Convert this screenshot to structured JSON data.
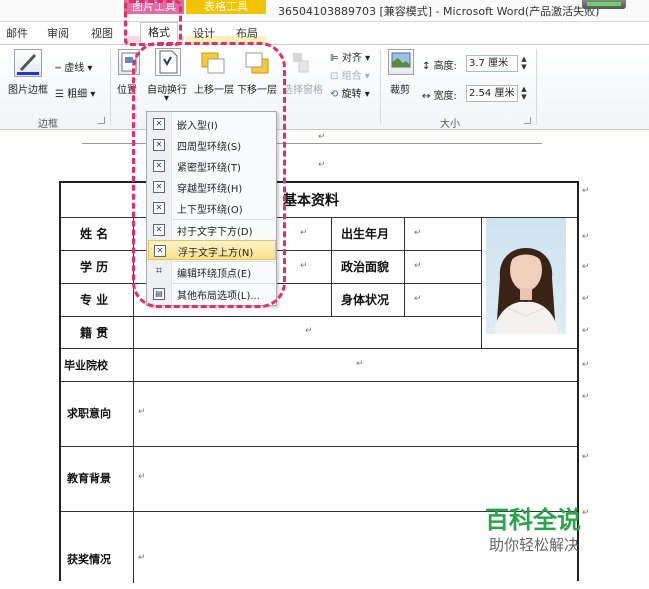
{
  "title_bar": {
    "context_tabs": [
      "图片工具",
      "表格工具"
    ],
    "doc_title": "36504103889703 [兼容模式] - Microsoft Word(产品激活失败)"
  },
  "tabs": [
    "邮件",
    "审阅",
    "视图",
    "格式",
    "设计",
    "布局"
  ],
  "ribbon": {
    "border_group": {
      "picture_border": "图片边框",
      "dashes": "虚线",
      "weight": "粗细",
      "label": "边框"
    },
    "arrange_group": {
      "position": "位置",
      "wrap_text": "自动换行",
      "bring_forward": "上移一层",
      "send_backward": "下移一层",
      "selection_pane": "选择窗格",
      "align": "对齐",
      "group": "组合",
      "rotate": "旋转"
    },
    "size_group": {
      "crop": "裁剪",
      "height_label": "高度:",
      "height_value": "3.7 厘米",
      "width_label": "宽度:",
      "width_value": "2.54 厘米",
      "label": "大小"
    }
  },
  "wrap_menu": {
    "items": [
      {
        "label": "嵌入型(I)",
        "icon": "inline-wrap-icon"
      },
      {
        "label": "四周型环绕(S)",
        "icon": "square-wrap-icon"
      },
      {
        "label": "紧密型环绕(T)",
        "icon": "tight-wrap-icon"
      },
      {
        "label": "穿越型环绕(H)",
        "icon": "through-wrap-icon"
      },
      {
        "label": "上下型环绕(O)",
        "icon": "top-bottom-wrap-icon"
      },
      {
        "label": "衬于文字下方(D)",
        "icon": "behind-text-icon"
      },
      {
        "label": "浮于文字上方(N)",
        "icon": "in-front-text-icon",
        "selected": true
      },
      {
        "label": "编辑环绕顶点(E)",
        "icon": "edit-wrap-points-icon"
      },
      {
        "label": "其他布局选项(L)...",
        "icon": "more-layout-icon"
      }
    ]
  },
  "document": {
    "table_title": "基本资料",
    "para_mark": "↵",
    "rows": {
      "name": "姓 名",
      "birth": "出生年月",
      "education": "学 历",
      "politics": "政治面貌",
      "major": "专 业",
      "health": "身体状况",
      "origin": "籍 贯",
      "school": "毕业院校",
      "job": "求职意向",
      "edu_bg": "教育背景",
      "awards": "获奖情况"
    }
  },
  "watermark": {
    "main": "百科全说",
    "sub": "助你轻松解决"
  },
  "colors": {
    "annotation": "#e0306a",
    "picture_tools": "#e06ca3",
    "table_tools": "#f2c300",
    "watermark": "#2aa34b"
  }
}
